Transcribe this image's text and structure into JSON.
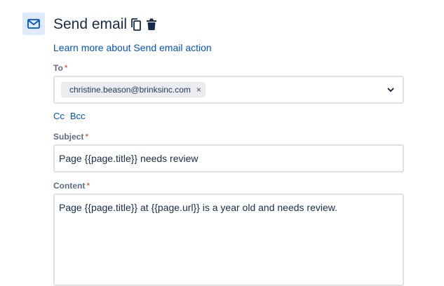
{
  "header": {
    "title": "Send email",
    "learn_link": "Learn more about Send email action",
    "icons": {
      "action": "envelope-icon",
      "copy": "copy-icon",
      "delete": "trash-icon"
    }
  },
  "to": {
    "label": "To",
    "required_mark": "*",
    "chips": [
      {
        "email": "christine.beason@brinksinc.com",
        "remove": "×"
      }
    ]
  },
  "cc_bcc": {
    "cc": "Cc",
    "bcc": "Bcc"
  },
  "subject": {
    "label": "Subject",
    "required_mark": "*",
    "value": "Page {{page.title}} needs review"
  },
  "content": {
    "label": "Content",
    "required_mark": "*",
    "value": "Page {{page.title}} at {{page.url}} is a year old and needs review."
  },
  "colors": {
    "accent": "#0052cc",
    "icon_bg": "#deebff",
    "required": "#de350b"
  }
}
